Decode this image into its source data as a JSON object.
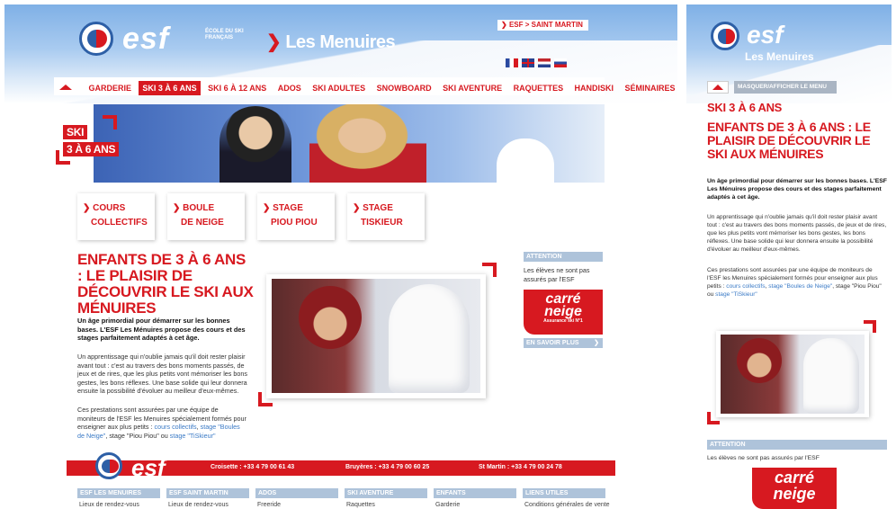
{
  "desktop": {
    "brand": {
      "logo_text": "esf",
      "logo_sub": "ÉCOLE DU SKI FRANÇAIS",
      "location": "Les Menuires"
    },
    "top_link": "ESF > SAINT MARTIN",
    "nav": {
      "items": [
        "GARDERIE",
        "SKI 3 À 6 ANS",
        "SKI 6 À 12 ANS",
        "ADOS",
        "SKI ADULTES",
        "SNOWBOARD",
        "SKI AVENTURE",
        "RAQUETTES",
        "HANDISKI",
        "SÉMINAIRES"
      ],
      "active": "SKI 3 À 6 ANS"
    },
    "banner_labels": [
      "SKI",
      "3 À 6 ANS"
    ],
    "subnav": [
      {
        "line1": "COURS",
        "line2": "COLLECTIFS"
      },
      {
        "line1": "BOULE",
        "line2": "DE NEIGE"
      },
      {
        "line1": "STAGE",
        "line2": "PIOU PIOU"
      },
      {
        "line1": "STAGE",
        "line2": "TISKIEUR"
      }
    ],
    "article": {
      "title": "ENFANTS DE 3 À 6 ANS : LE PLAISIR DE DÉCOUVRIR LE SKI AUX MÉNUIRES",
      "lead": "Un âge primordial pour démarrer sur les bonnes bases. L'ESF Les Ménuires propose des cours et des stages parfaitement adaptés à cet âge.",
      "p1": "Un apprentissage qui n'oublie jamais qu'il doit rester plaisir avant tout : c'est au travers des bons moments passés, de jeux et de rires, que les plus petits vont mémoriser les bons gestes, les bons réflexes. Une base solide qui leur donnera ensuite la possibilité d'évoluer au meilleur d'eux-mêmes.",
      "p2_start": "Ces prestations sont assurées par une équipe de moniteurs de l'ESF les Menuires spécialement formés pour enseigner aux plus petits : ",
      "link1": "cours collectifs",
      "link2": "stage \"Boules de Neige\"",
      "p2_mid": ", stage \"Piou Piou\" ou ",
      "link3": "stage \"TiSkieur\""
    },
    "attention": {
      "title": "ATTENTION",
      "text": "Les élèves ne sont pas assurés par l'ESF",
      "brand_line1": "carré",
      "brand_line2": "neige",
      "brand_tag": "Assurance ski N°1",
      "more": "EN SAVOIR PLUS"
    },
    "footer": {
      "logo_text": "esf",
      "phones": [
        "Croisette : +33 4 79 00 61 43",
        "Bruyères : +33 4 79 00 60 25",
        "St Martin : +33 4 79 00 24 78"
      ],
      "cols": [
        {
          "title": "ESF LES MENUIRES",
          "first": "Lieux de rendez-vous"
        },
        {
          "title": "ESF SAINT MARTIN",
          "first": "Lieux de rendez-vous"
        },
        {
          "title": "ADOS",
          "first": "Freeride"
        },
        {
          "title": "SKI AVENTURE",
          "first": "Raquettes"
        },
        {
          "title": "ENFANTS",
          "first": "Garderie"
        },
        {
          "title": "LIENS UTILES",
          "first": "Conditions générales de vente"
        }
      ]
    }
  },
  "mobile": {
    "location": "Les Menuires",
    "menu_toggle": "MASQUER/AFFICHER LE MENU",
    "section": "SKI 3 À 6 ANS",
    "title": "ENFANTS DE 3 À 6 ANS : LE PLAISIR DE DÉCOUVRIR LE SKI AUX MÉNUIRES",
    "attention_title": "ATTENTION",
    "attention_text": "Les élèves ne sont pas assurés par l'ESF"
  },
  "colors": {
    "accent": "#d71920",
    "muted_blue": "#aec3da",
    "link": "#3a7ac6"
  }
}
